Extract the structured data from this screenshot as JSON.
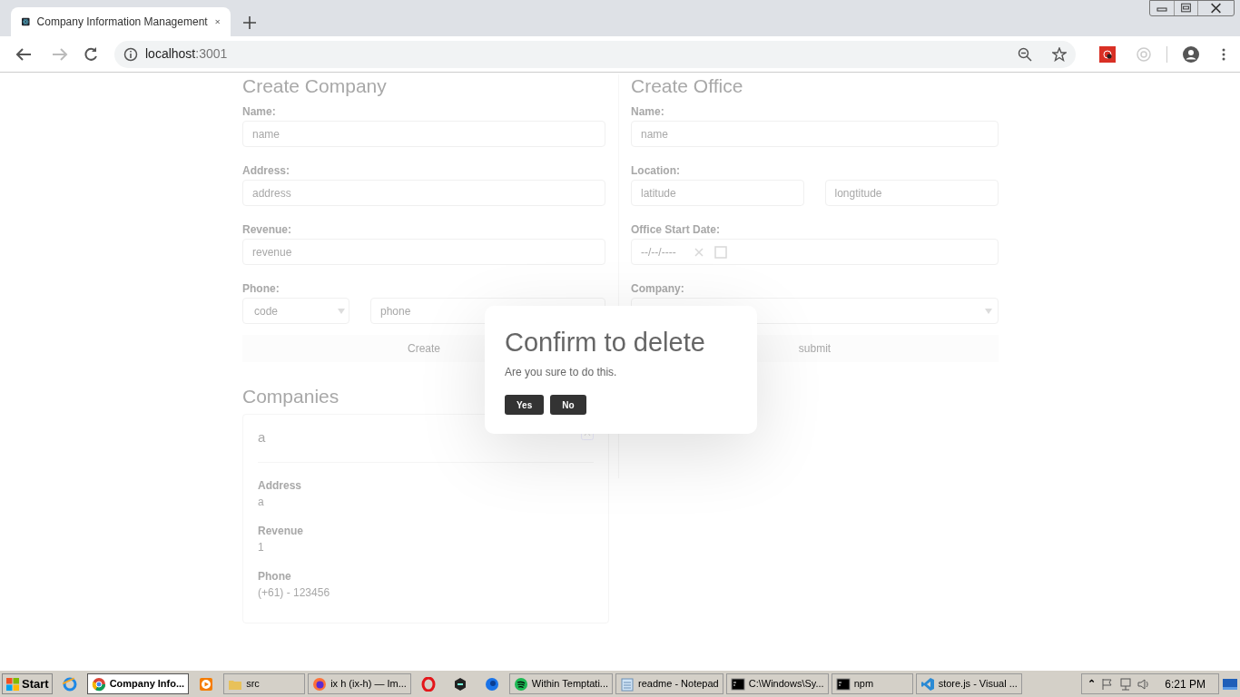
{
  "browser": {
    "tab_title": "Company Information Management",
    "url_host": "localhost",
    "url_port": ":3001"
  },
  "create_company": {
    "title": "Create Company",
    "fields": [
      {
        "label": "Name:",
        "kind": "text",
        "placeholder": "name"
      },
      {
        "label": "Address:",
        "kind": "text",
        "placeholder": "address"
      },
      {
        "label": "Revenue:",
        "kind": "text",
        "placeholder": "revenue"
      },
      {
        "label": "Phone:",
        "kind": "select_text",
        "select_placeholder": "code",
        "placeholder": "phone"
      }
    ],
    "button": "Create"
  },
  "create_office": {
    "title": "Create Office",
    "fields": [
      {
        "label": "Name:",
        "kind": "text",
        "placeholder": "name"
      },
      {
        "label": "Location:",
        "kind": "pair",
        "placeholder": "latitude",
        "placeholder_2": "longtitude"
      },
      {
        "label": "Office Start Date:",
        "kind": "date",
        "placeholder": "--/--/----"
      },
      {
        "label": "Company:",
        "kind": "select"
      }
    ],
    "button": "submit"
  },
  "companies": {
    "title": "Companies",
    "cards": [
      {
        "name": "a",
        "details": [
          {
            "label": "Address",
            "value": "a"
          },
          {
            "label": "Revenue",
            "value": "1"
          },
          {
            "label": "Phone",
            "value": "(+61) - 123456"
          }
        ]
      }
    ]
  },
  "dialog": {
    "title": "Confirm to delete",
    "message": "Are you sure to do this.",
    "buttons": [
      "Yes",
      "No"
    ]
  },
  "taskbar": {
    "start": "Start",
    "items": [
      {
        "kind": "icon"
      },
      {
        "kind": "window",
        "label": "Company Info...",
        "selected": true
      },
      {
        "kind": "icon"
      },
      {
        "kind": "window",
        "label": "src",
        "selected": false
      },
      {
        "kind": "window",
        "label": "ix h (ix-h) — Im...",
        "selected": false
      },
      {
        "kind": "icon"
      },
      {
        "kind": "icon"
      },
      {
        "kind": "icon"
      },
      {
        "kind": "window",
        "label": "Within Temptati...",
        "selected": false
      },
      {
        "kind": "window",
        "label": "readme - Notepad",
        "selected": false
      },
      {
        "kind": "window",
        "label": "C:\\Windows\\Sy...",
        "selected": false
      },
      {
        "kind": "window",
        "label": "npm",
        "selected": false
      },
      {
        "kind": "window",
        "label": "store.js - Visual ...",
        "selected": false
      }
    ],
    "tray_expand": "⌃",
    "clock": "6:21 PM"
  }
}
